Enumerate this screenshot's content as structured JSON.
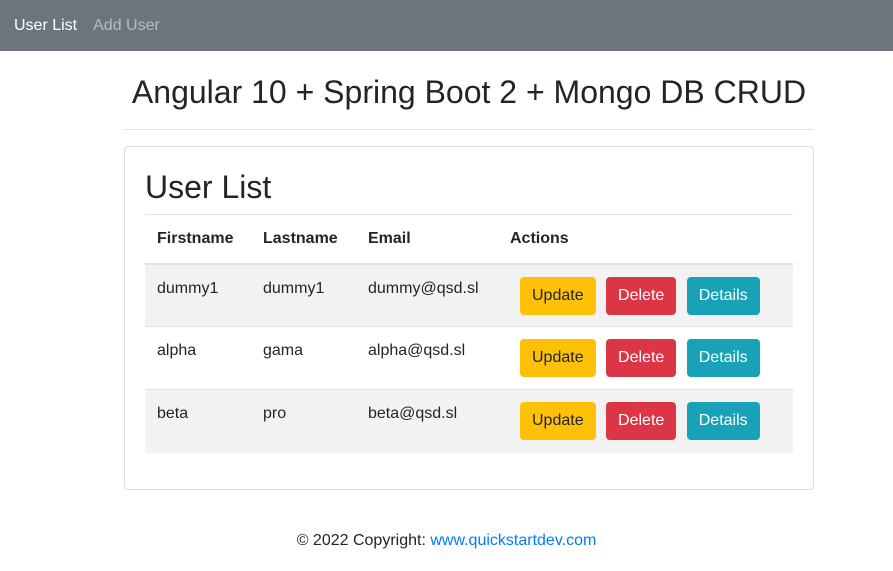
{
  "nav": {
    "items": [
      {
        "label": "User List",
        "active": true
      },
      {
        "label": "Add User",
        "active": false
      }
    ],
    "background": "#6c757d"
  },
  "page": {
    "title": "Angular 10 + Spring Boot 2 + Mongo DB CRUD"
  },
  "card": {
    "title": "User List"
  },
  "table": {
    "headers": [
      "Firstname",
      "Lastname",
      "Email",
      "Actions"
    ],
    "rows": [
      {
        "firstname": "dummy1",
        "lastname": "dummy1",
        "email": "dummy@qsd.sl"
      },
      {
        "firstname": "alpha",
        "lastname": "gama",
        "email": "alpha@qsd.sl"
      },
      {
        "firstname": "beta",
        "lastname": "pro",
        "email": "beta@qsd.sl"
      }
    ],
    "actions": {
      "update_label": "Update",
      "delete_label": "Delete",
      "details_label": "Details"
    }
  },
  "colors": {
    "update": "#ffc107",
    "delete": "#dc3545",
    "details": "#17a2b8",
    "link": "#007bff"
  },
  "footer": {
    "text": "© 2022 Copyright: ",
    "link_text": "www.quickstartdev.com"
  }
}
